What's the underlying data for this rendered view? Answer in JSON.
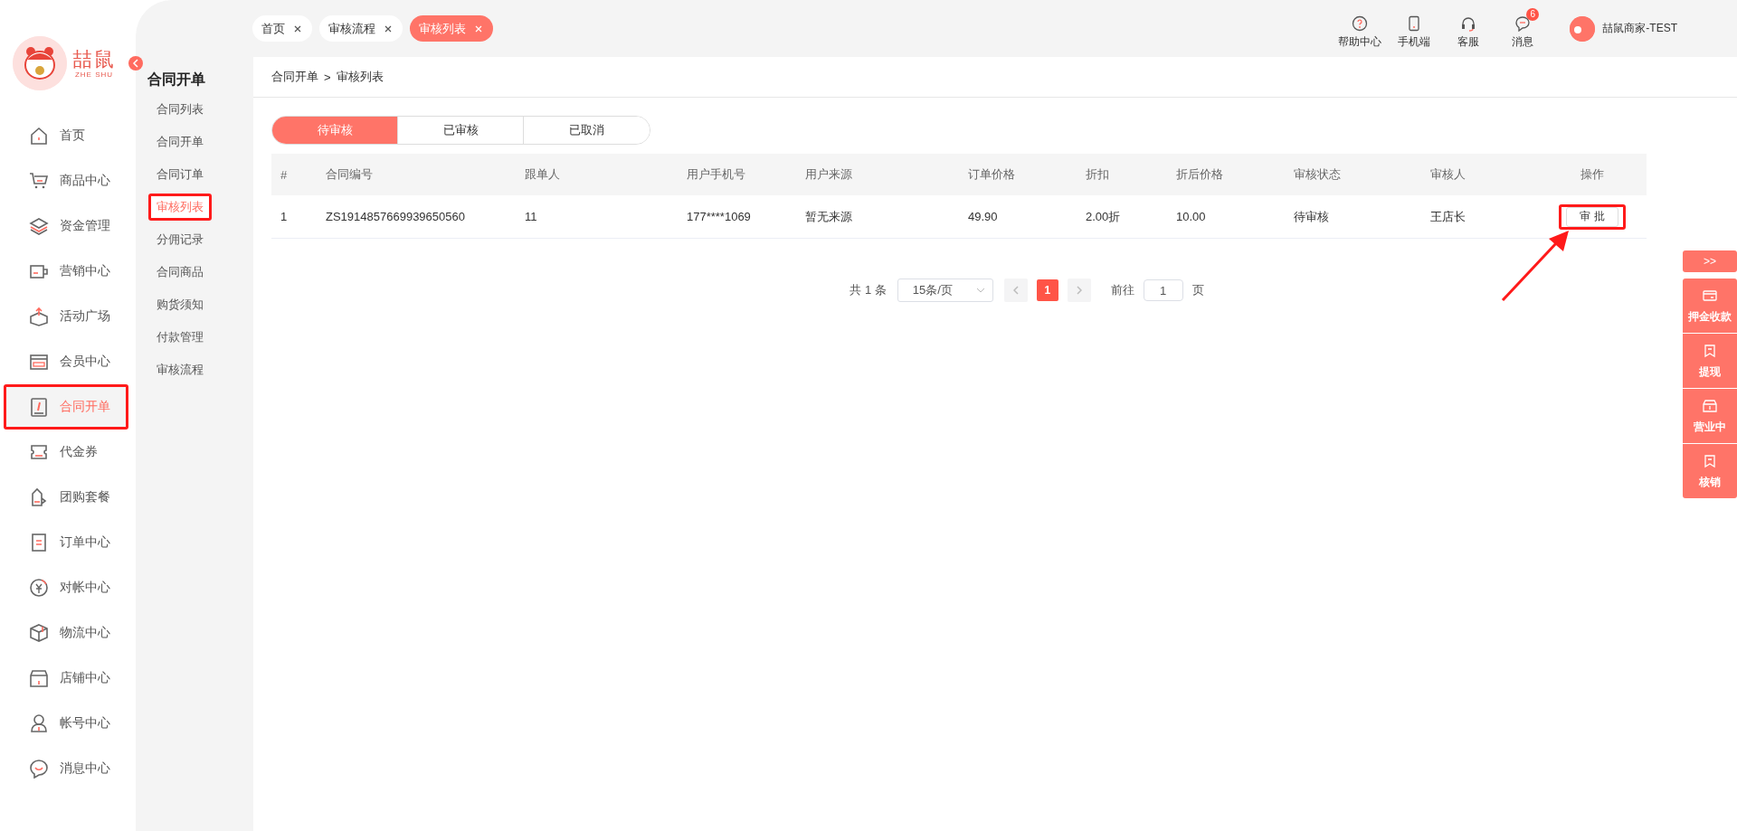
{
  "sidebar": {
    "logo_text": "喆鼠",
    "logo_subtext": "ZHE SHU",
    "items": [
      {
        "label": "首页",
        "selected": false,
        "annotated": false
      },
      {
        "label": "商品中心",
        "selected": false,
        "annotated": false
      },
      {
        "label": "资金管理",
        "selected": false,
        "annotated": false
      },
      {
        "label": "营销中心",
        "selected": false,
        "annotated": false
      },
      {
        "label": "活动广场",
        "selected": false,
        "annotated": false
      },
      {
        "label": "会员中心",
        "selected": false,
        "annotated": false
      },
      {
        "label": "合同开单",
        "selected": true,
        "annotated": true
      },
      {
        "label": "代金券",
        "selected": false,
        "annotated": false
      },
      {
        "label": "团购套餐",
        "selected": false,
        "annotated": false
      },
      {
        "label": "订单中心",
        "selected": false,
        "annotated": false
      },
      {
        "label": "对帐中心",
        "selected": false,
        "annotated": false
      },
      {
        "label": "物流中心",
        "selected": false,
        "annotated": false
      },
      {
        "label": "店铺中心",
        "selected": false,
        "annotated": false
      },
      {
        "label": "帐号中心",
        "selected": false,
        "annotated": false
      },
      {
        "label": "消息中心",
        "selected": false,
        "annotated": false
      }
    ]
  },
  "subnav": {
    "title": "合同开单",
    "items": [
      {
        "label": "合同列表",
        "selected": false,
        "annotated": false
      },
      {
        "label": "合同开单",
        "selected": false,
        "annotated": false
      },
      {
        "label": "合同订单",
        "selected": false,
        "annotated": false
      },
      {
        "label": "审核列表",
        "selected": true,
        "annotated": true
      },
      {
        "label": "分佣记录",
        "selected": false,
        "annotated": false
      },
      {
        "label": "合同商品",
        "selected": false,
        "annotated": false
      },
      {
        "label": "购货须知",
        "selected": false,
        "annotated": false
      },
      {
        "label": "付款管理",
        "selected": false,
        "annotated": false
      },
      {
        "label": "审核流程",
        "selected": false,
        "annotated": false
      }
    ]
  },
  "page_tabs": [
    {
      "label": "首页",
      "selected": false
    },
    {
      "label": "审核流程",
      "selected": false
    },
    {
      "label": "审核列表",
      "selected": true
    }
  ],
  "header_tools": [
    {
      "label": "帮助中心"
    },
    {
      "label": "手机端"
    },
    {
      "label": "客服"
    },
    {
      "label": "消息",
      "badge": "6"
    }
  ],
  "user": {
    "name": "喆鼠商家-TEST"
  },
  "breadcrumb": {
    "parent": "合同开单",
    "separator": ">",
    "current": "审核列表"
  },
  "status_tabs": [
    {
      "label": "待审核",
      "selected": true
    },
    {
      "label": "已审核",
      "selected": false
    },
    {
      "label": "已取消",
      "selected": false
    }
  ],
  "table": {
    "columns": [
      "#",
      "合同编号",
      "跟单人",
      "用户手机号",
      "用户来源",
      "订单价格",
      "折扣",
      "折后价格",
      "审核状态",
      "审核人",
      "操作"
    ],
    "rows": [
      {
        "cells": [
          "1",
          "ZS1914857669939650560",
          "11",
          "177****1069",
          "暂无来源",
          "49.90",
          "2.00折",
          "10.00",
          "待审核",
          "王店长"
        ],
        "action": "审 批",
        "action_annotated": true
      }
    ]
  },
  "pagination": {
    "total": "共 1 条",
    "page_size": "15条/页",
    "pages": [
      {
        "label": "1",
        "selected": true
      }
    ],
    "goto_label": "前往",
    "goto_value": "1",
    "goto_suffix": "页"
  },
  "float_panel": {
    "toggle": ">>",
    "items": [
      {
        "label": "押金收款"
      },
      {
        "label": "提现"
      },
      {
        "label": "营业中"
      },
      {
        "label": "核销"
      }
    ]
  },
  "annotations": [
    {
      "kind": "arrow"
    }
  ]
}
